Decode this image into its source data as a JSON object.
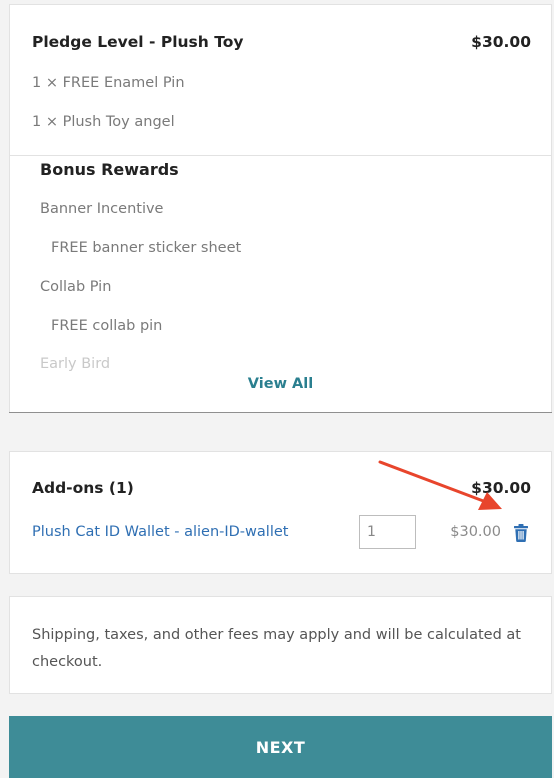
{
  "pledge": {
    "title": "Pledge Level - Plush Toy",
    "price": "$30.00",
    "items": [
      "1 × FREE Enamel Pin",
      "1 × Plush Toy angel"
    ]
  },
  "bonus": {
    "heading": "Bonus Rewards",
    "items": [
      {
        "label": "Banner Incentive"
      },
      {
        "label": "FREE banner sticker sheet"
      },
      {
        "label": "Collab Pin"
      },
      {
        "label": "FREE collab pin"
      },
      {
        "label": "Early Bird"
      }
    ],
    "view_all": "View All"
  },
  "addons": {
    "title": "Add-ons (1)",
    "total": "$30.00",
    "item": {
      "name": "Plush Cat ID Wallet - alien-ID-wallet",
      "quantity": "1",
      "price": "$30.00",
      "delete_icon": "trash-icon"
    }
  },
  "notice": {
    "text": "Shipping, taxes, and other fees may apply and will be calculated at checkout."
  },
  "next_button": {
    "label": "NEXT"
  },
  "colors": {
    "accent": "#3e8c97",
    "link": "#2f6fb3",
    "annotation_arrow": "#e8452c"
  }
}
